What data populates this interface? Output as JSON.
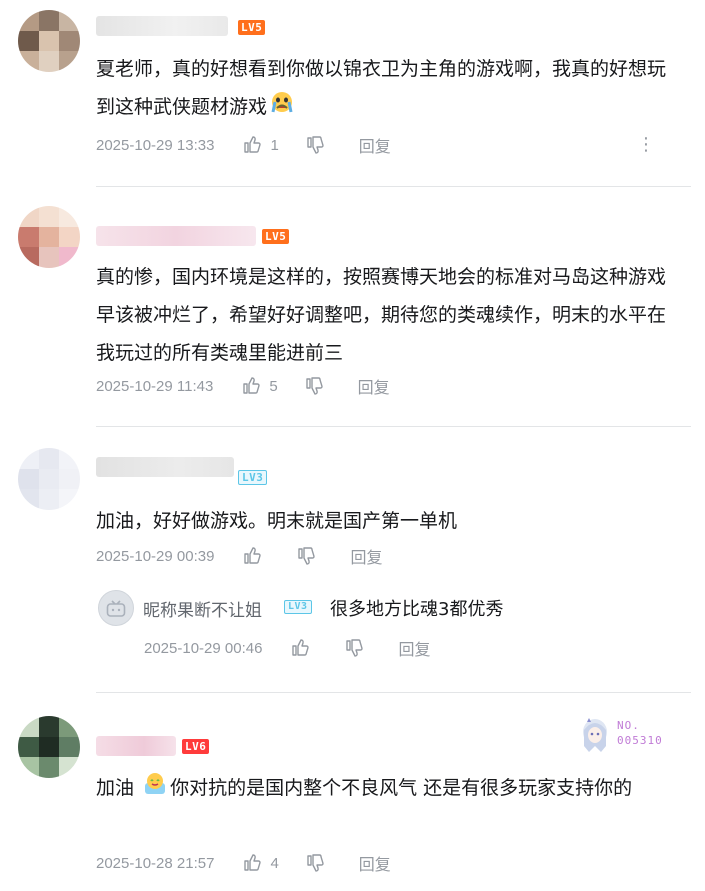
{
  "comments": [
    {
      "level": "LV5",
      "content": "夏老师，真的好想看到你做以锦衣卫为主角的游戏啊，我真的好想玩到这种武侠题材游戏",
      "time": "2025-10-29 13:33",
      "likes": "1",
      "reply_label": "回复"
    },
    {
      "level": "LV5",
      "content": "真的惨，国内环境是这样的，按照赛博天地会的标准对马岛这种游戏早该被冲烂了，希望好好调整吧，期待您的类魂续作，明末的水平在我玩过的所有类魂里能进前三",
      "time": "2025-10-29 11:43",
      "likes": "5",
      "reply_label": "回复"
    },
    {
      "level": "LV3",
      "content": "加油，好好做游戏。明末就是国产第一单机",
      "time": "2025-10-29 00:39",
      "likes": "",
      "reply_label": "回复",
      "sub_reply": {
        "username": "昵称果断不让姐",
        "level": "LV3",
        "content": "很多地方比魂3都优秀",
        "time": "2025-10-29 00:46",
        "reply_label": "回复"
      }
    },
    {
      "level": "LV6",
      "content_a": "加油",
      "content_b": "你对抗的是国内整个不良风气 还是有很多玩家支持你的",
      "badge_no": "NO.\n005310",
      "time": "2025-10-28 21:57",
      "likes": "4",
      "reply_label": "回复"
    }
  ],
  "colors": {
    "accent_lv5": "#ff6f1c",
    "accent_lv3": "#5cc6e7",
    "accent_lv6": "#ff3b3b",
    "meta_gray": "#9499a0",
    "text": "#18191c"
  },
  "icons": [
    "like-icon",
    "dislike-icon",
    "more-icon",
    "crying-emoji-icon",
    "cheer-emoji-icon",
    "tv-avatar-icon"
  ]
}
